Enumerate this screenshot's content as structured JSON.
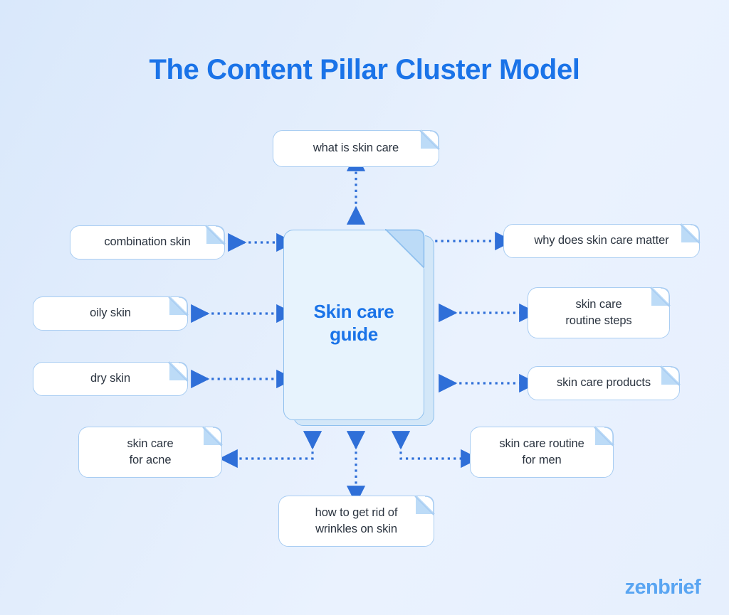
{
  "page": {
    "title": "The Content Pillar Cluster Model",
    "brand": "zenbrief"
  },
  "colors": {
    "title_blue": "#1a73e8",
    "brand_blue": "#59a5f2",
    "arrow_blue": "#2f6fd8",
    "card_border": "#a9cdf2",
    "card_fill": "#ffffff",
    "card_fold": "#bcdbf7",
    "pillar_fill": "#e7f3fd",
    "pillar_back_fill": "#d3e7f8",
    "pillar_border": "#8fc0ee",
    "text_dark": "#2b3440",
    "background_from": "#d9e8fb",
    "background_to": "#eaf2fe"
  },
  "pillar": {
    "label": "Skin care\nguide",
    "line1": "Skin care",
    "line2": "guide"
  },
  "clusters": [
    {
      "id": "what-is-skin-care",
      "label": "what is skin care",
      "position": "top"
    },
    {
      "id": "combination-skin",
      "label": "combination skin",
      "position": "left-1"
    },
    {
      "id": "oily-skin",
      "label": "oily skin",
      "position": "left-2"
    },
    {
      "id": "dry-skin",
      "label": "dry skin",
      "position": "left-3"
    },
    {
      "id": "skin-care-for-acne",
      "label": "skin care\nfor acne",
      "position": "bottom-left"
    },
    {
      "id": "how-to-get-rid-of-wrinkles-on-skin",
      "label": "how to get rid of\nwrinkles on skin",
      "position": "bottom"
    },
    {
      "id": "skin-care-routine-for-men",
      "label": "skin care routine\nfor men",
      "position": "bottom-right"
    },
    {
      "id": "why-does-skin-care-matter",
      "label": "why does skin care matter",
      "position": "right-1"
    },
    {
      "id": "skin-care-routine-steps",
      "label": "skin care\nroutine steps",
      "position": "right-2"
    },
    {
      "id": "skin-care-products",
      "label": "skin care products",
      "position": "right-3"
    }
  ],
  "cluster_labels": {
    "what_is_skin_care": "what is skin care",
    "combination_skin": "combination skin",
    "oily_skin": "oily skin",
    "dry_skin": "dry skin",
    "skin_care_for_acne_l1": "skin care",
    "skin_care_for_acne_l2": "for acne",
    "wrinkles_l1": "how to get rid of",
    "wrinkles_l2": "wrinkles on skin",
    "routine_for_men_l1": "skin care routine",
    "routine_for_men_l2": "for men",
    "why_does_skin_care_matter": "why does skin care matter",
    "routine_steps_l1": "skin care",
    "routine_steps_l2": "routine steps",
    "skin_care_products": "skin care products"
  },
  "connectors": {
    "style": "dotted double-headed arrow",
    "count": 10
  }
}
